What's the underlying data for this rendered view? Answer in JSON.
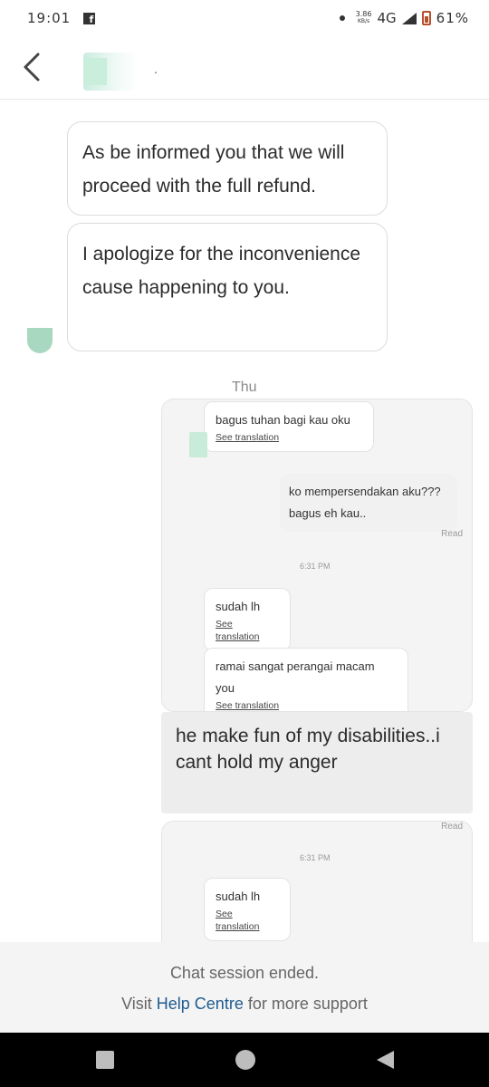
{
  "status_bar": {
    "time": "19:01",
    "app_icon": "facebook-icon",
    "speed_value": "3.86",
    "speed_unit": "KB/s",
    "network": "4G",
    "battery": "61%",
    "battery_color": "#b5502c"
  },
  "header": {
    "back_icon": "chevron-left-icon",
    "name": "."
  },
  "messages": [
    {
      "text": "As be informed you that we will proceed with the full refund."
    },
    {
      "text": "I apologize for the inconvenience cause happening to you."
    }
  ],
  "day_label": "Thu",
  "screenshot": {
    "bubble_1": {
      "text": "bagus tuhan bagi kau oku",
      "see_translation": "See translation"
    },
    "own_1": {
      "text": "ko mempersendakan aku??? bagus eh kau.."
    },
    "read_1": "Read",
    "time_1": "6:31 PM",
    "bubble_2": {
      "text": "sudah lh",
      "see_translation": "See translation"
    },
    "bubble_3": {
      "text": "ramai sangat perangai macam you",
      "see_translation": "See translation"
    }
  },
  "overlay_message": "he make fun of my disabilities..i cant hold my anger",
  "screenshot_2": {
    "read": "Read",
    "time": "6:31 PM",
    "bubble": {
      "text": "sudah lh",
      "see_translation": "See translation"
    }
  },
  "footer": {
    "ended": "Chat session ended.",
    "support_prefix": "Visit ",
    "support_link": "Help Centre",
    "support_suffix": " for more support",
    "link_color": "#1e5c8f"
  }
}
